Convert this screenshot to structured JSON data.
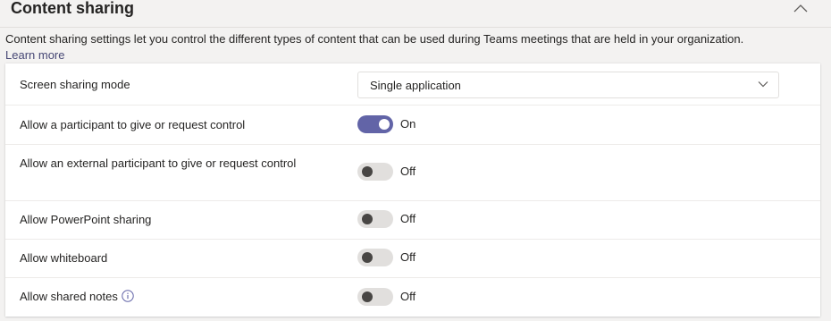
{
  "section": {
    "title": "Content sharing",
    "description": "Content sharing settings let you control the different types of content that can be used during Teams meetings that are held in your organization.",
    "learn_more": "Learn more",
    "collapse_icon": "chevron-up-icon"
  },
  "settings": {
    "screen_sharing_mode": {
      "label": "Screen sharing mode",
      "value": "Single application",
      "chevron_icon": "chevron-down-icon"
    },
    "give_request_control": {
      "label": "Allow a participant to give or request control",
      "state": "On"
    },
    "external_give_request_control": {
      "label": "Allow an external participant to give or request control",
      "state": "Off"
    },
    "powerpoint_sharing": {
      "label": "Allow PowerPoint sharing",
      "state": "Off"
    },
    "whiteboard": {
      "label": "Allow whiteboard",
      "state": "Off"
    },
    "shared_notes": {
      "label": "Allow shared notes",
      "state": "Off",
      "info_icon": "info-icon"
    }
  },
  "colors": {
    "accent": "#6264a7",
    "link": "#464775",
    "toggle_off_track": "#e1dfdd",
    "toggle_off_knob": "#484644"
  }
}
